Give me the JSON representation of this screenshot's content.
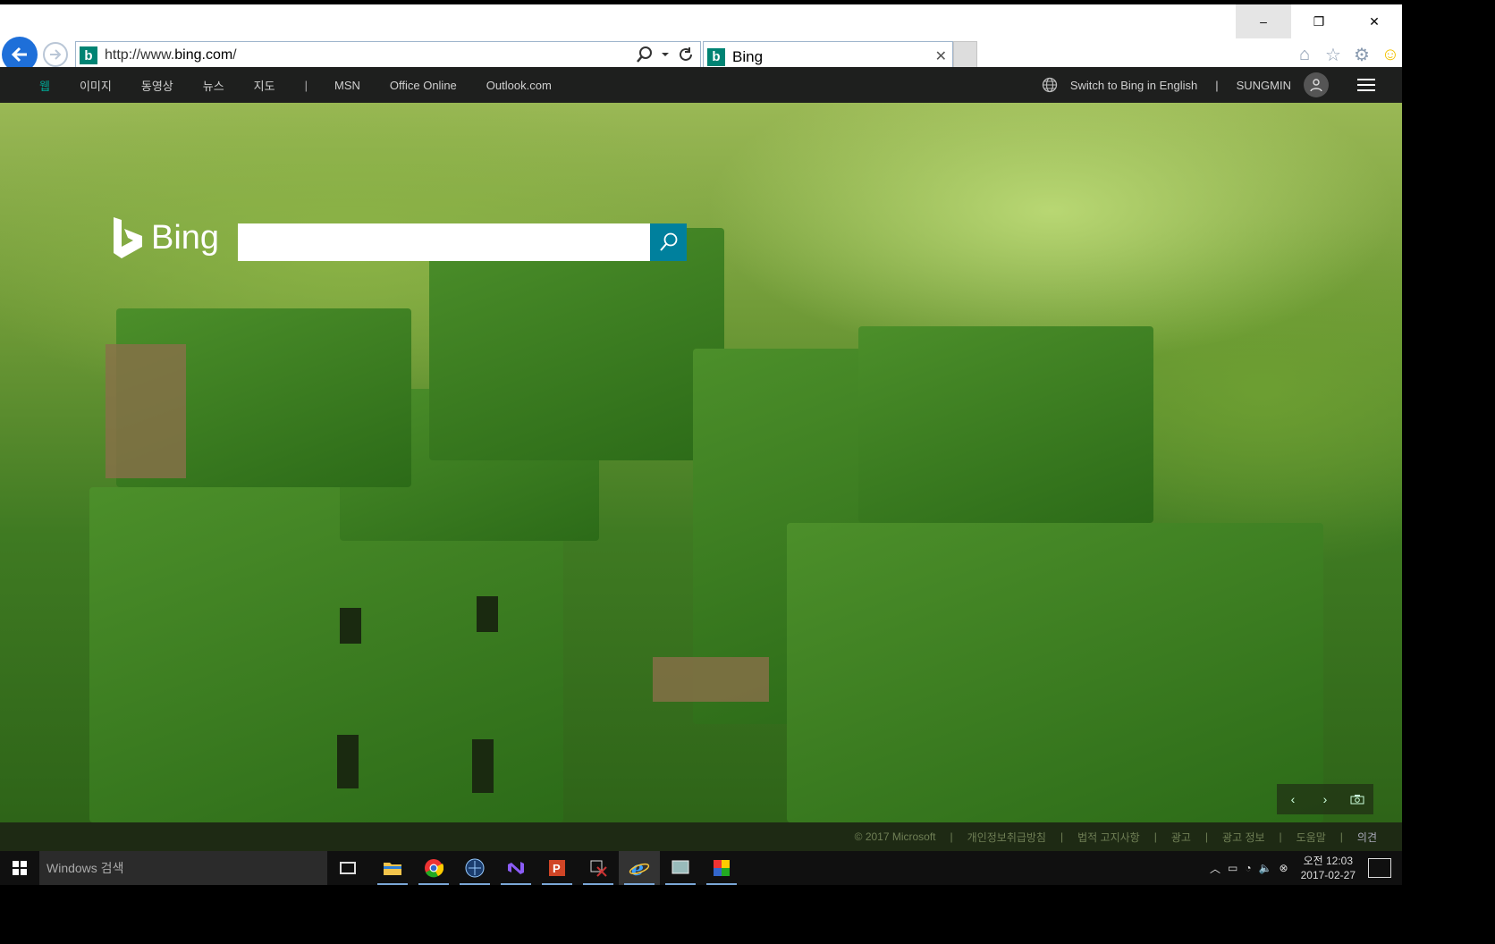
{
  "browser": {
    "url_prefix": "http://www.",
    "url_host": "bing.com",
    "url_suffix": "/",
    "tab_title": "Bing",
    "favicon_letter": "b"
  },
  "window_controls": {
    "minimize": "–",
    "restore": "❐",
    "close": "✕"
  },
  "bing_nav": {
    "items": [
      "웹",
      "이미지",
      "동영상",
      "뉴스",
      "지도"
    ],
    "separator": "|",
    "links": [
      "MSN",
      "Office Online",
      "Outlook.com"
    ],
    "switch_lang": "Switch to Bing in English",
    "right_sep": "|",
    "user": "SUNGMIN"
  },
  "bing": {
    "logo_text": "Bing",
    "search_placeholder": ""
  },
  "footer": {
    "items": [
      "© 2017 Microsoft",
      "개인정보취급방침",
      "법적 고지사항",
      "광고",
      "광고 정보",
      "도움말",
      "의견"
    ]
  },
  "taskbar": {
    "search_text": "Windows 검색",
    "time": "오전 12:03",
    "date": "2017-02-27"
  },
  "colors": {
    "bing_teal": "#00809d",
    "nav_active": "#00a795",
    "ie_blue": "#1e6fd9"
  }
}
